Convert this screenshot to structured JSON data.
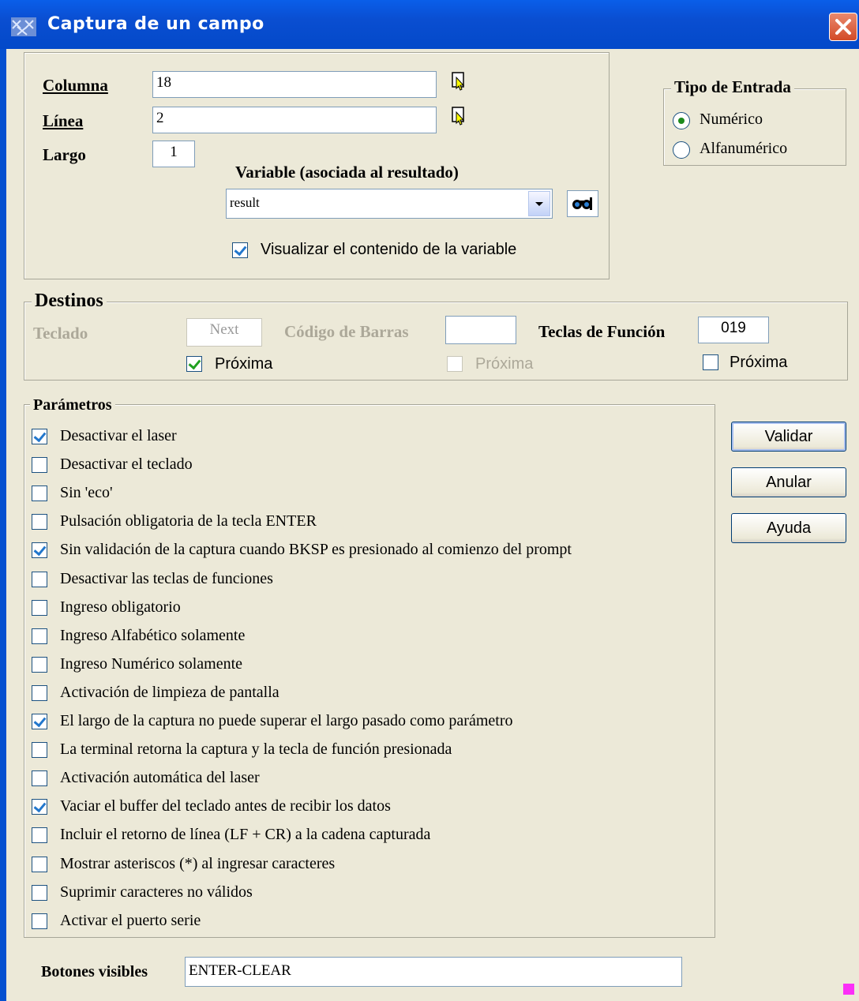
{
  "window": {
    "title": "Captura de un campo"
  },
  "top": {
    "columna_label": "Columna",
    "columna_value": "18",
    "linea_label": "Línea",
    "linea_value": "2",
    "largo_label": "Largo",
    "largo_value": "1",
    "variable_label": "Variable (asociada al resultado)",
    "variable_value": "result",
    "visualizar_label": "Visualizar el contenido de la variable",
    "visualizar_checked": true
  },
  "tipo_entrada": {
    "legend": "Tipo de Entrada",
    "options": [
      {
        "label": "Numérico",
        "selected": true
      },
      {
        "label": "Alfanumérico",
        "selected": false
      }
    ]
  },
  "destinos": {
    "legend": "Destinos",
    "teclado_label": "Teclado",
    "teclado_value": "Next",
    "teclado_proxima": "Próxima",
    "barras_label": "Código de Barras",
    "barras_value": "",
    "barras_proxima": "Próxima",
    "funcion_label": "Teclas de Función",
    "funcion_value": "019",
    "funcion_proxima": "Próxima"
  },
  "parametros": {
    "legend": "Parámetros",
    "items": [
      {
        "label": "Desactivar el laser",
        "checked": true
      },
      {
        "label": "Desactivar el teclado",
        "checked": false
      },
      {
        "label": "Sin 'eco'",
        "checked": false
      },
      {
        "label": "Pulsación obligatoria de la tecla ENTER",
        "checked": false
      },
      {
        "label": "Sin validación de la captura cuando BKSP es presionado al comienzo del prompt",
        "checked": true
      },
      {
        "label": "Desactivar las teclas de funciones",
        "checked": false
      },
      {
        "label": "Ingreso obligatorio",
        "checked": false
      },
      {
        "label": "Ingreso Alfabético solamente",
        "checked": false
      },
      {
        "label": "Ingreso Numérico solamente",
        "checked": false
      },
      {
        "label": "Activación de limpieza de pantalla",
        "checked": false
      },
      {
        "label": "El largo de la captura no puede superar el largo pasado como parámetro",
        "checked": true
      },
      {
        "label": "La terminal retorna la captura y la tecla de función presionada",
        "checked": false
      },
      {
        "label": "Activación automática del laser",
        "checked": false
      },
      {
        "label": "Vaciar el buffer del teclado antes de recibir los datos",
        "checked": true
      },
      {
        "label": "Incluir el retorno de línea (LF + CR) a la cadena capturada",
        "checked": false
      },
      {
        "label": "Mostrar asteriscos (*) al ingresar caracteres",
        "checked": false
      },
      {
        "label": "Suprimir caracteres no válidos",
        "checked": false
      },
      {
        "label": "Activar el puerto serie",
        "checked": false
      }
    ]
  },
  "buttons": {
    "validar": "Validar",
    "anular": "Anular",
    "ayuda": "Ayuda"
  },
  "botones_visibles": {
    "label": "Botones visibles",
    "value": "ENTER-CLEAR"
  }
}
